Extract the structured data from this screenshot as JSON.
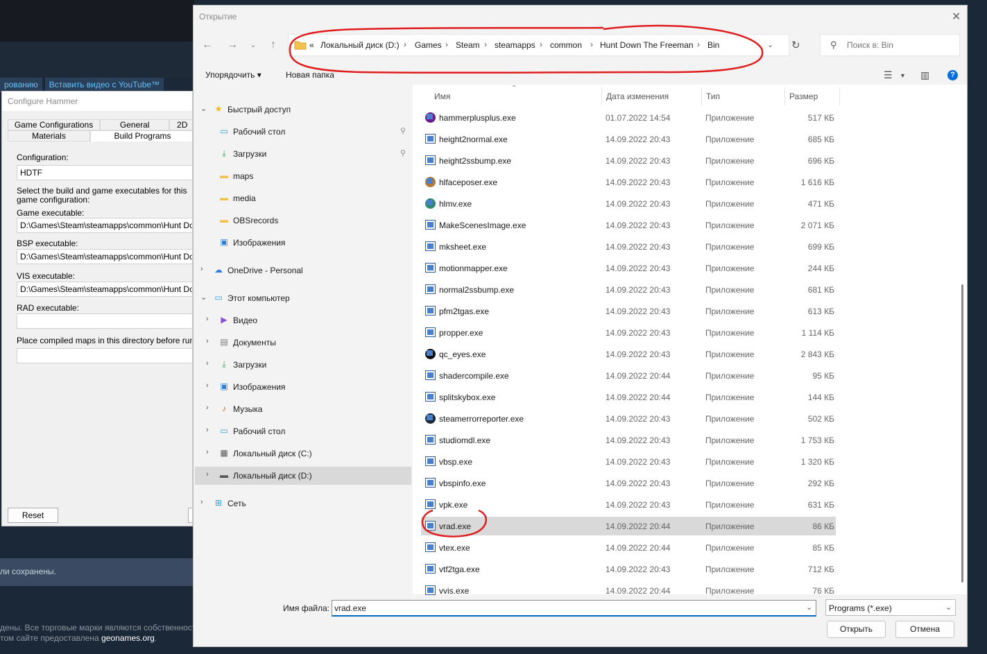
{
  "background": {
    "toolbar_left": "рованию",
    "toolbar_right": "Вставить видео с YouTube™",
    "saved_text": "ли сохранены.",
    "footer_line1": "дены. Все торговые марки являются собственност",
    "footer_line2_pre": "том сайте предоставлена ",
    "footer_link": "geonames.org",
    "footer_line2_post": "."
  },
  "hammer": {
    "title": "Configure Hammer",
    "tabs_row1": [
      "Game Configurations",
      "General",
      "2D"
    ],
    "tabs_row2": [
      "Materials",
      "Build Programs"
    ],
    "configuration_label": "Configuration:",
    "configuration_value": "HDTF",
    "description": "Select the build and game executables for this game configuration:",
    "game_label": "Game executable:",
    "game_value": "D:\\Games\\Steam\\steamapps\\common\\Hunt Down T",
    "bsp_label": "BSP executable:",
    "bsp_value": "D:\\Games\\Steam\\steamapps\\common\\Hunt Down T",
    "vis_label": "VIS executable:",
    "vis_value": "D:\\Games\\Steam\\steamapps\\common\\Hunt Down T",
    "rad_label": "RAD executable:",
    "rad_value": "",
    "place_label": "Place compiled maps in this directory before running th",
    "place_value": "",
    "reset_label": "Reset"
  },
  "dialog": {
    "title": "Открытие",
    "address": {
      "prefix": "«",
      "crumbs": [
        "Локальный диск (D:)",
        "Games",
        "Steam",
        "steamapps",
        "common",
        "Hunt Down The Freeman",
        "Bin"
      ]
    },
    "search_placeholder": "Поиск в: Bin",
    "organize_label": "Упорядочить ▾",
    "new_folder_label": "Новая папка",
    "nav": [
      {
        "label": "Быстрый доступ",
        "icon": "star-icon",
        "chev": "⌄",
        "level": 0,
        "pin": false
      },
      {
        "label": "Рабочий стол",
        "icon": "desktop-icon",
        "chev": "",
        "level": 1,
        "pin": true
      },
      {
        "label": "Загрузки",
        "icon": "download-icon",
        "chev": "",
        "level": 1,
        "pin": true
      },
      {
        "label": "maps",
        "icon": "folder-icon",
        "chev": "",
        "level": 1,
        "pin": false
      },
      {
        "label": "media",
        "icon": "folder-icon",
        "chev": "",
        "level": 1,
        "pin": false
      },
      {
        "label": "OBSrecords",
        "icon": "folder-icon",
        "chev": "",
        "level": 1,
        "pin": false
      },
      {
        "label": "Изображения",
        "icon": "pictures-icon",
        "chev": "",
        "level": 1,
        "pin": false
      },
      {
        "label": "OneDrive - Personal",
        "icon": "cloud-icon",
        "chev": "›",
        "level": 0,
        "pin": false
      },
      {
        "label": "Этот компьютер",
        "icon": "computer-icon",
        "chev": "⌄",
        "level": 0,
        "pin": false
      },
      {
        "label": "Видео",
        "icon": "video-icon",
        "chev": "›",
        "level": 1,
        "pin": false
      },
      {
        "label": "Документы",
        "icon": "documents-icon",
        "chev": "›",
        "level": 1,
        "pin": false
      },
      {
        "label": "Загрузки",
        "icon": "download-icon",
        "chev": "›",
        "level": 1,
        "pin": false
      },
      {
        "label": "Изображения",
        "icon": "pictures-icon",
        "chev": "›",
        "level": 1,
        "pin": false
      },
      {
        "label": "Музыка",
        "icon": "music-icon",
        "chev": "›",
        "level": 1,
        "pin": false
      },
      {
        "label": "Рабочий стол",
        "icon": "desktop-icon",
        "chev": "›",
        "level": 1,
        "pin": false
      },
      {
        "label": "Локальный диск (C:)",
        "icon": "drive-c-icon",
        "chev": "›",
        "level": 1,
        "pin": false
      },
      {
        "label": "Локальный диск (D:)",
        "icon": "drive-icon",
        "chev": "›",
        "level": 1,
        "pin": false,
        "selected": true
      },
      {
        "label": "Сеть",
        "icon": "network-icon",
        "chev": "›",
        "level": 0,
        "pin": false
      }
    ],
    "columns": [
      "Имя",
      "Дата изменения",
      "Тип",
      "Размер"
    ],
    "files": [
      {
        "name": "hammerplusplus.exe",
        "date": "01.07.2022 14:54",
        "type": "Приложение",
        "size": "517 КБ",
        "icon": "hammerplusplus-icon"
      },
      {
        "name": "height2normal.exe",
        "date": "14.09.2022 20:43",
        "type": "Приложение",
        "size": "685 КБ",
        "icon": "exe-icon"
      },
      {
        "name": "height2ssbump.exe",
        "date": "14.09.2022 20:43",
        "type": "Приложение",
        "size": "696 КБ",
        "icon": "exe-icon"
      },
      {
        "name": "hlfaceposer.exe",
        "date": "14.09.2022 20:43",
        "type": "Приложение",
        "size": "1 616 КБ",
        "icon": "faceposer-icon"
      },
      {
        "name": "hlmv.exe",
        "date": "14.09.2022 20:43",
        "type": "Приложение",
        "size": "471 КБ",
        "icon": "hlmv-icon"
      },
      {
        "name": "MakeScenesImage.exe",
        "date": "14.09.2022 20:43",
        "type": "Приложение",
        "size": "2 071 КБ",
        "icon": "exe-icon"
      },
      {
        "name": "mksheet.exe",
        "date": "14.09.2022 20:43",
        "type": "Приложение",
        "size": "699 КБ",
        "icon": "exe-icon"
      },
      {
        "name": "motionmapper.exe",
        "date": "14.09.2022 20:43",
        "type": "Приложение",
        "size": "244 КБ",
        "icon": "exe-icon"
      },
      {
        "name": "normal2ssbump.exe",
        "date": "14.09.2022 20:43",
        "type": "Приложение",
        "size": "681 КБ",
        "icon": "exe-icon"
      },
      {
        "name": "pfm2tgas.exe",
        "date": "14.09.2022 20:43",
        "type": "Приложение",
        "size": "613 КБ",
        "icon": "exe-icon"
      },
      {
        "name": "propper.exe",
        "date": "14.09.2022 20:43",
        "type": "Приложение",
        "size": "1 114 КБ",
        "icon": "exe-icon"
      },
      {
        "name": "qc_eyes.exe",
        "date": "14.09.2022 20:43",
        "type": "Приложение",
        "size": "2 843 КБ",
        "icon": "qc-eyes-icon"
      },
      {
        "name": "shadercompile.exe",
        "date": "14.09.2022 20:44",
        "type": "Приложение",
        "size": "95 КБ",
        "icon": "exe-icon"
      },
      {
        "name": "splitskybox.exe",
        "date": "14.09.2022 20:44",
        "type": "Приложение",
        "size": "144 КБ",
        "icon": "exe-icon"
      },
      {
        "name": "steamerrorreporter.exe",
        "date": "14.09.2022 20:43",
        "type": "Приложение",
        "size": "502 КБ",
        "icon": "steam-icon"
      },
      {
        "name": "studiomdl.exe",
        "date": "14.09.2022 20:43",
        "type": "Приложение",
        "size": "1 753 КБ",
        "icon": "exe-icon"
      },
      {
        "name": "vbsp.exe",
        "date": "14.09.2022 20:43",
        "type": "Приложение",
        "size": "1 320 КБ",
        "icon": "exe-icon"
      },
      {
        "name": "vbspinfo.exe",
        "date": "14.09.2022 20:43",
        "type": "Приложение",
        "size": "292 КБ",
        "icon": "exe-icon"
      },
      {
        "name": "vpk.exe",
        "date": "14.09.2022 20:43",
        "type": "Приложение",
        "size": "631 КБ",
        "icon": "exe-icon"
      },
      {
        "name": "vrad.exe",
        "date": "14.09.2022 20:44",
        "type": "Приложение",
        "size": "86 КБ",
        "icon": "exe-icon",
        "selected": true
      },
      {
        "name": "vtex.exe",
        "date": "14.09.2022 20:44",
        "type": "Приложение",
        "size": "85 КБ",
        "icon": "exe-icon"
      },
      {
        "name": "vtf2tga.exe",
        "date": "14.09.2022 20:43",
        "type": "Приложение",
        "size": "712 КБ",
        "icon": "exe-icon"
      },
      {
        "name": "vvis.exe",
        "date": "14.09.2022 20:44",
        "type": "Приложение",
        "size": "76 КБ",
        "icon": "exe-icon"
      }
    ],
    "filename_label": "Имя файла:",
    "filename_value": "vrad.exe",
    "filetype_value": "Programs (*.exe)",
    "open_label": "Открыть",
    "cancel_label": "Отмена"
  },
  "colors": {
    "annotation": "#e01b1b",
    "accent": "#0067c0",
    "selection": "#d9d9d9"
  }
}
